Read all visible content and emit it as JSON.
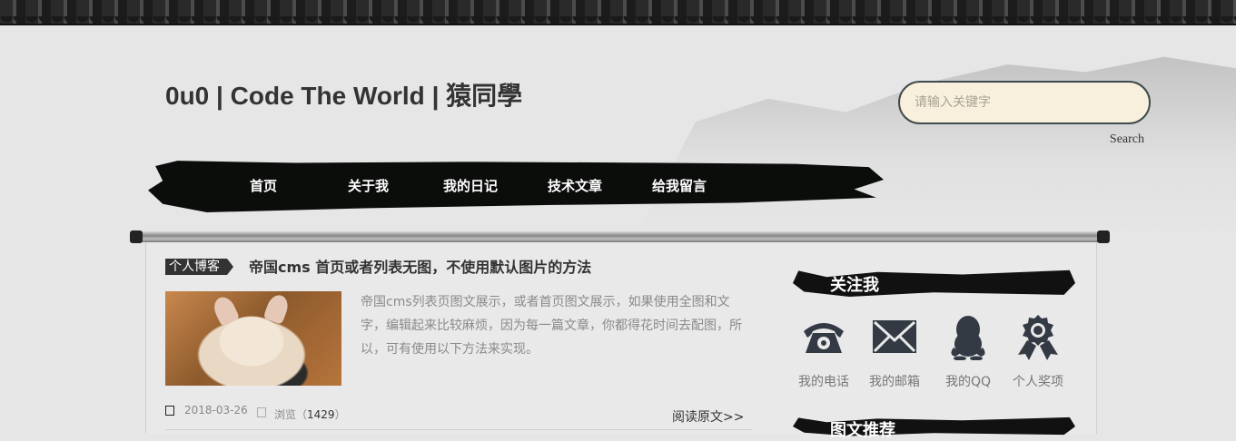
{
  "header": {
    "site_title": "0u0 | Code The World | 猿同學",
    "search": {
      "placeholder": "请输入关键字",
      "value": "",
      "button_label": "Search"
    }
  },
  "nav": {
    "items": [
      {
        "label": "首页"
      },
      {
        "label": "关于我"
      },
      {
        "label": "我的日记"
      },
      {
        "label": "技术文章"
      },
      {
        "label": "给我留言"
      }
    ]
  },
  "article": {
    "category": "个人博客",
    "title": "帝国cms 首页或者列表无图，不使用默认图片的方法",
    "excerpt": "帝国cms列表页图文展示，或者首页图文展示，如果使用全图和文字，编辑起来比较麻烦，因为每一篇文章，你都得花时间去配图，所以，可有使用以下方法来实现。",
    "date": "2018-03-26",
    "views_prefix": "浏览（",
    "views_count": "1429",
    "views_suffix": "）",
    "read_more": "阅读原文>>"
  },
  "sidebar": {
    "follow_heading": "关注我",
    "follow_items": [
      {
        "label": "我的电话",
        "icon": "phone-icon"
      },
      {
        "label": "我的邮箱",
        "icon": "envelope-icon"
      },
      {
        "label": "我的QQ",
        "icon": "qq-penguin-icon"
      },
      {
        "label": "个人奖项",
        "icon": "award-ribbon-icon"
      }
    ],
    "recommend_heading": "图文推荐"
  },
  "colors": {
    "ink": "#111111",
    "search_bg": "#f8f0dc",
    "search_border": "#3e4a4c",
    "icon": "#333a44"
  }
}
